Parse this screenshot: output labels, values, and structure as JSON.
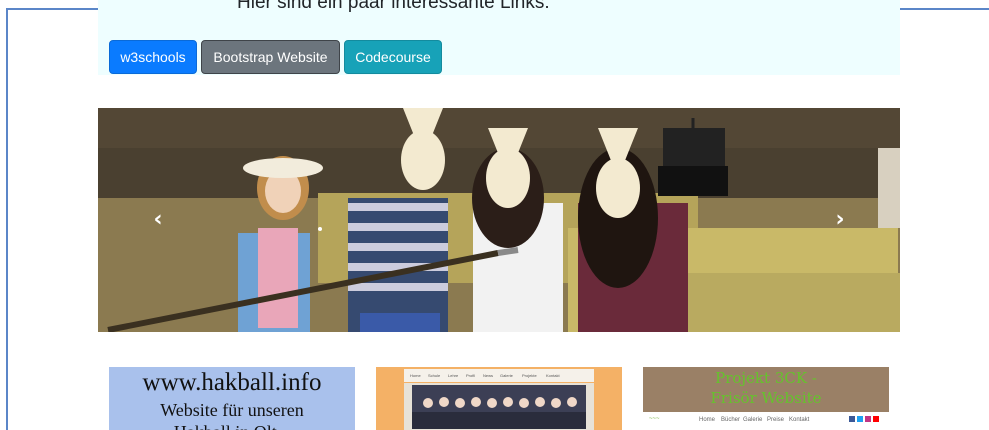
{
  "jumbotron": {
    "text": "Hier sind ein paar interessante Links:"
  },
  "buttons": {
    "w3schools": "w3schools",
    "bootstrap": "Bootstrap Website",
    "codecourse": "Codecourse"
  },
  "carousel": {
    "prev_symbol": "‹",
    "next_symbol": "›"
  },
  "cards": {
    "hakball": {
      "line1": "www.hakball.info",
      "line2": "Website für unseren",
      "line3": "Hakball in Olt..."
    },
    "project": {
      "title_line1": "Projekt 3CK -",
      "title_line2": "Frisör Website",
      "nav": [
        "Home",
        "Bücher",
        "Galerie",
        "Preise",
        "Kontakt"
      ]
    },
    "school": {
      "nav": [
        "Home",
        "Schule",
        "Lehre",
        "Profil",
        "News",
        "Galerie",
        "Projekte",
        "Kontakt"
      ]
    }
  },
  "colors": {
    "primary": "#0a7bff",
    "secondary": "#6c757d",
    "info": "#17a2b8",
    "jumbotron_bg": "#eefeff",
    "card_hakball_bg": "#a9c1ec",
    "card_school_bg": "#f4b166",
    "card_project_bg": "#9a8066",
    "project_title": "#65c32c"
  }
}
